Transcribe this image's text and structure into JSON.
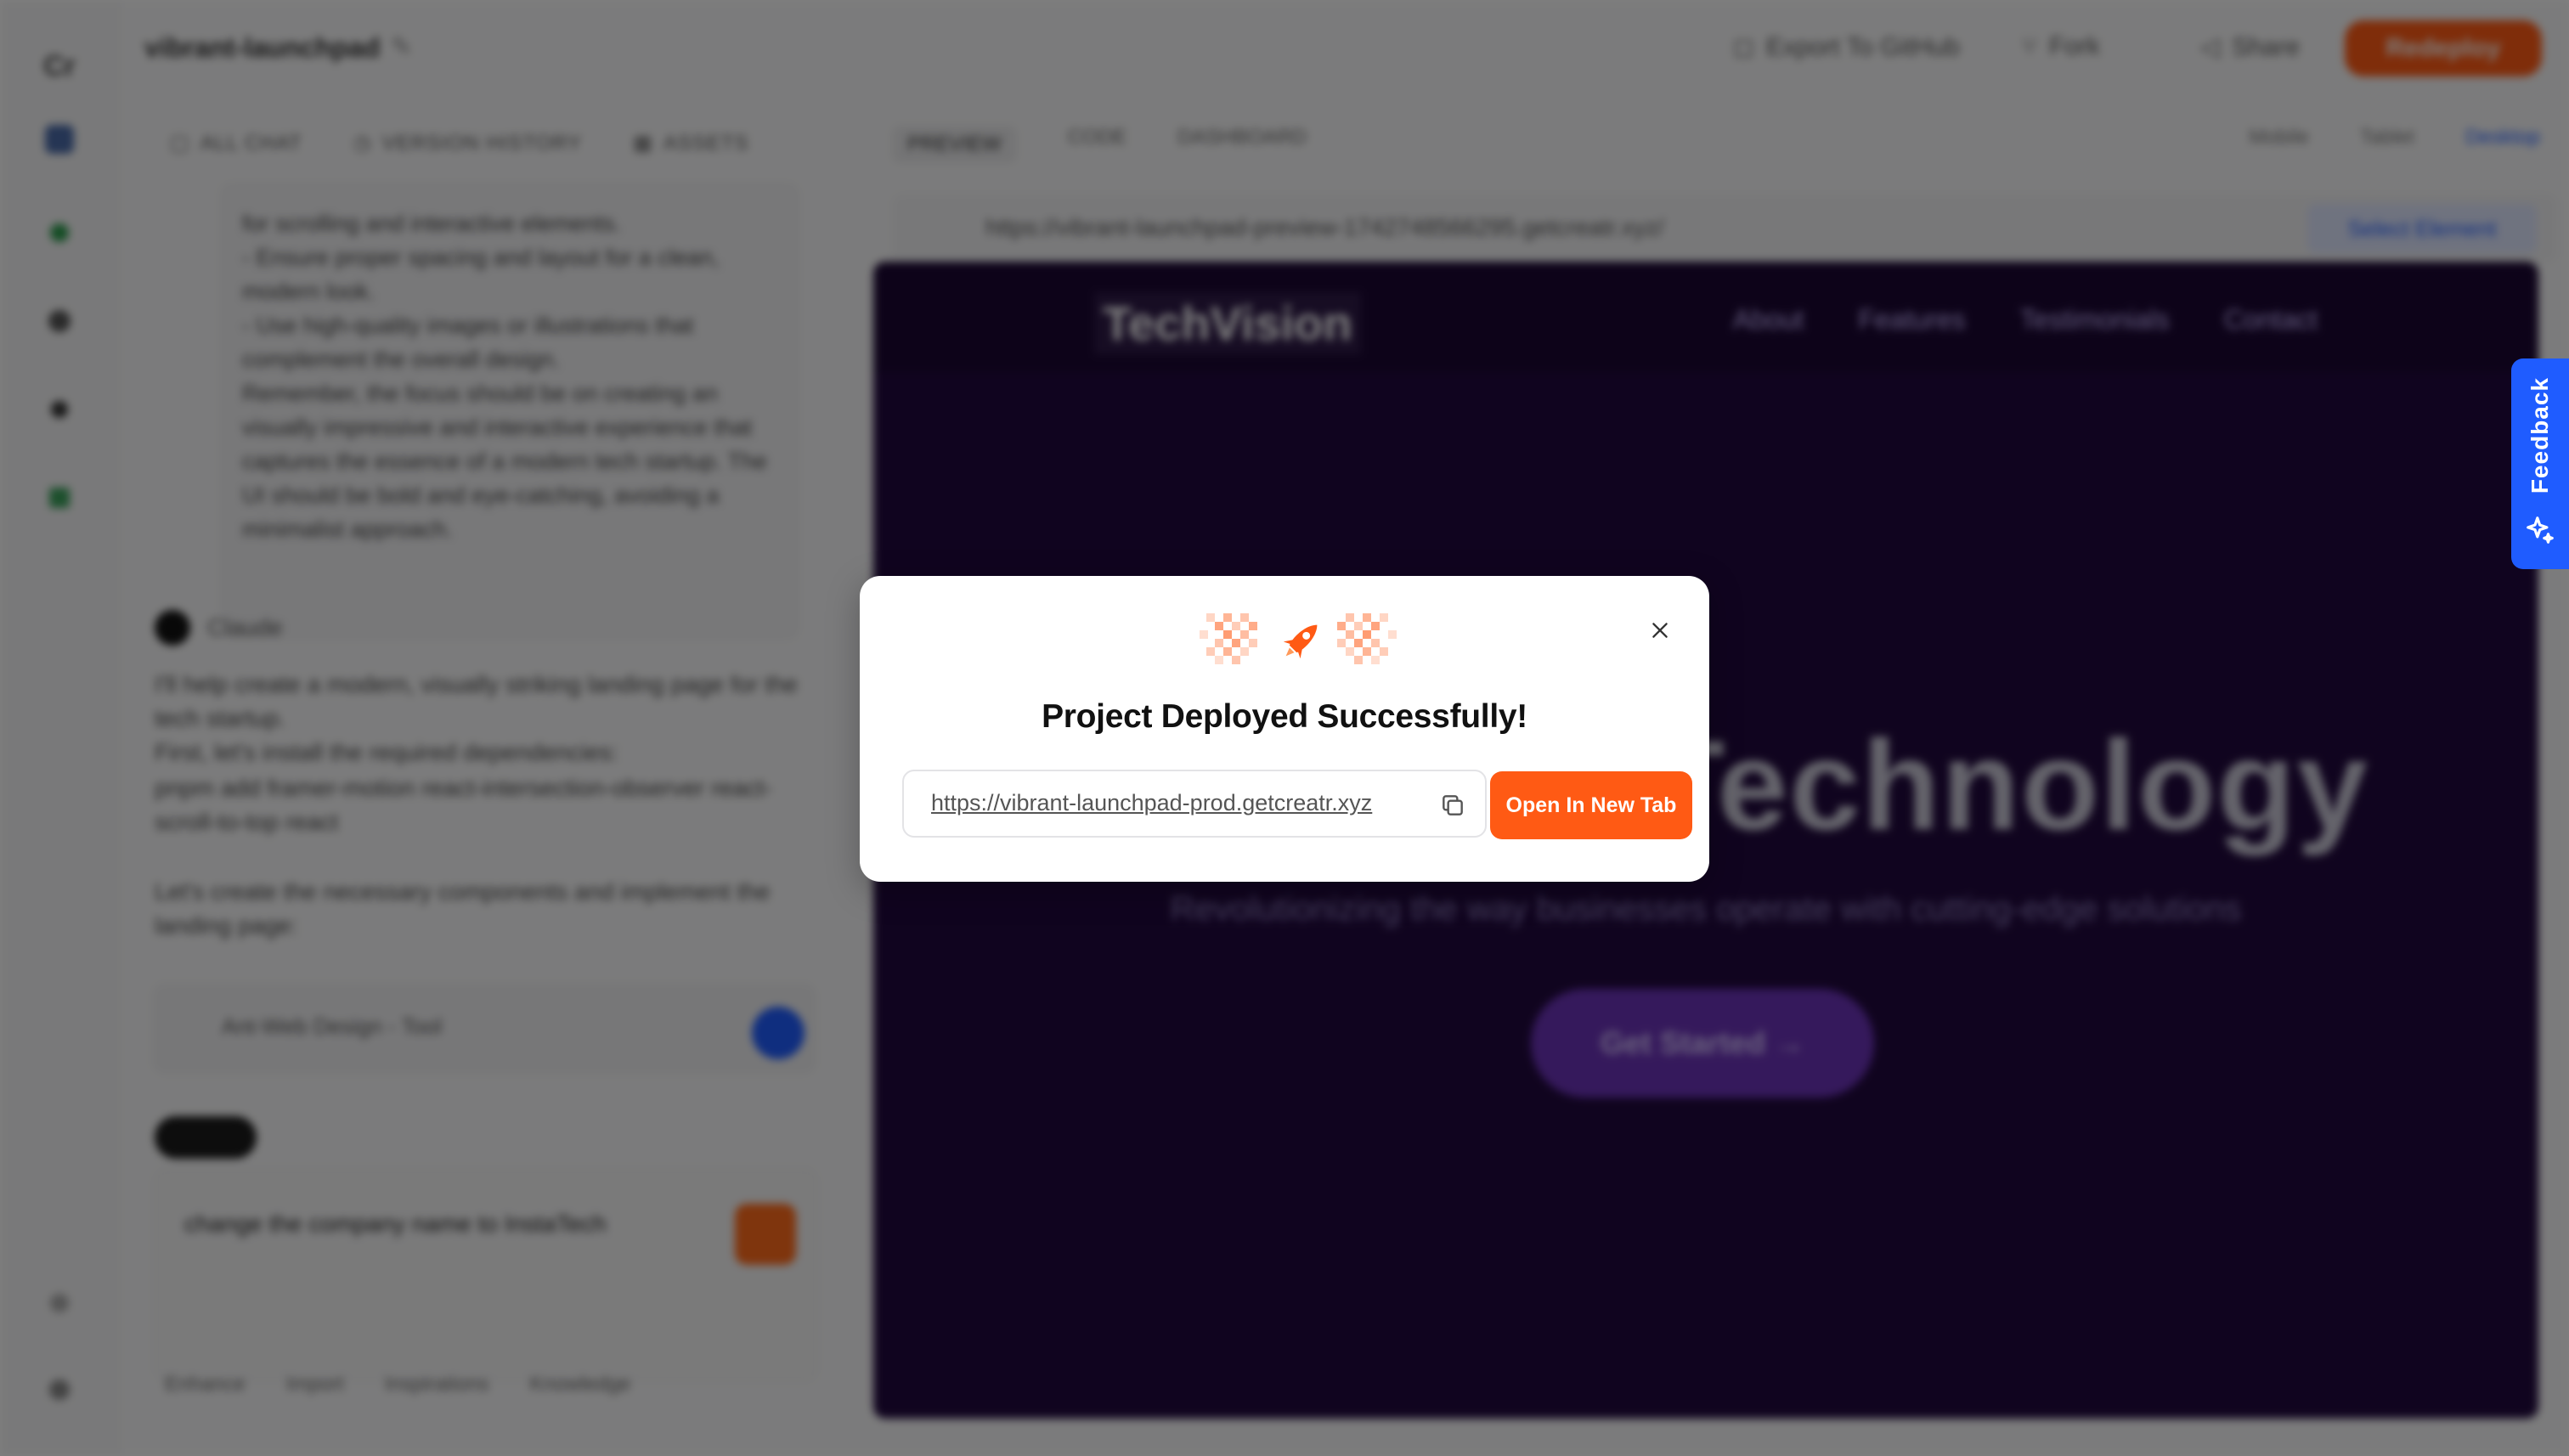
{
  "app": {
    "project_title": "vibrant-launchpad",
    "top_actions": [
      "Export To GitHub",
      "Fork",
      "Share"
    ],
    "publish_label": "Redeploy"
  },
  "chat": {
    "tabs": [
      "ALL CHAT",
      "VERSION HISTORY",
      "ASSETS"
    ],
    "code_excerpt": "for scrolling and interactive elements.\n- Ensure proper spacing and layout for a clean, modern look.\n- Use high-quality images or illustrations that complement the overall design.\nRemember, the focus should be on creating an visually impressive and interactive experience that captures the essence of a modern tech startup. The UI should be bold and eye-catching, avoiding a minimalist approach.",
    "assistant_name": "Claude",
    "message_1": "I'll help create a modern, visually striking landing page for the tech startup.\nFirst, let's install the required dependencies:",
    "message_2": "pnpm add framer-motion react-intersection-observer react-scroll-to-top react",
    "message_3": "Let's create the necessary components and implement the landing page:",
    "artifact_title": "Ant-Web Design - Tool",
    "prompt_text": "change the company name to InstaTech",
    "prompt_tools": [
      "Enhance",
      "Import",
      "Inspirations",
      "Knowledge"
    ]
  },
  "preview": {
    "tabs": [
      "PREVIEW",
      "CODE",
      "DASHBOARD"
    ],
    "devices": [
      "Mobile",
      "Tablet",
      "Desktop"
    ],
    "url": "https://vibrant-launchpad-preview-1742748566295.getcreatr.xyz/",
    "select_element_label": "Select Element",
    "site": {
      "logo": "TechVision",
      "nav": [
        "About",
        "Features",
        "Testimonials",
        "Contact"
      ],
      "hero": "Future of Technology",
      "subtitle": "Revolutionizing the way businesses operate with cutting-edge solutions",
      "cta": "Get Started →"
    }
  },
  "feedback": {
    "label": "Feedback"
  },
  "modal": {
    "title": "Project Deployed Successfully!",
    "url": "https://vibrant-launchpad-prod.getcreatr.xyz",
    "open_button": "Open In New Tab",
    "icons": {
      "close": "close-icon",
      "copy": "copy-icon",
      "hero": "rocket-icon"
    }
  },
  "colors": {
    "accent": "#ff5a14",
    "feedback": "#1f5cff",
    "site_bg": "#21093e"
  }
}
